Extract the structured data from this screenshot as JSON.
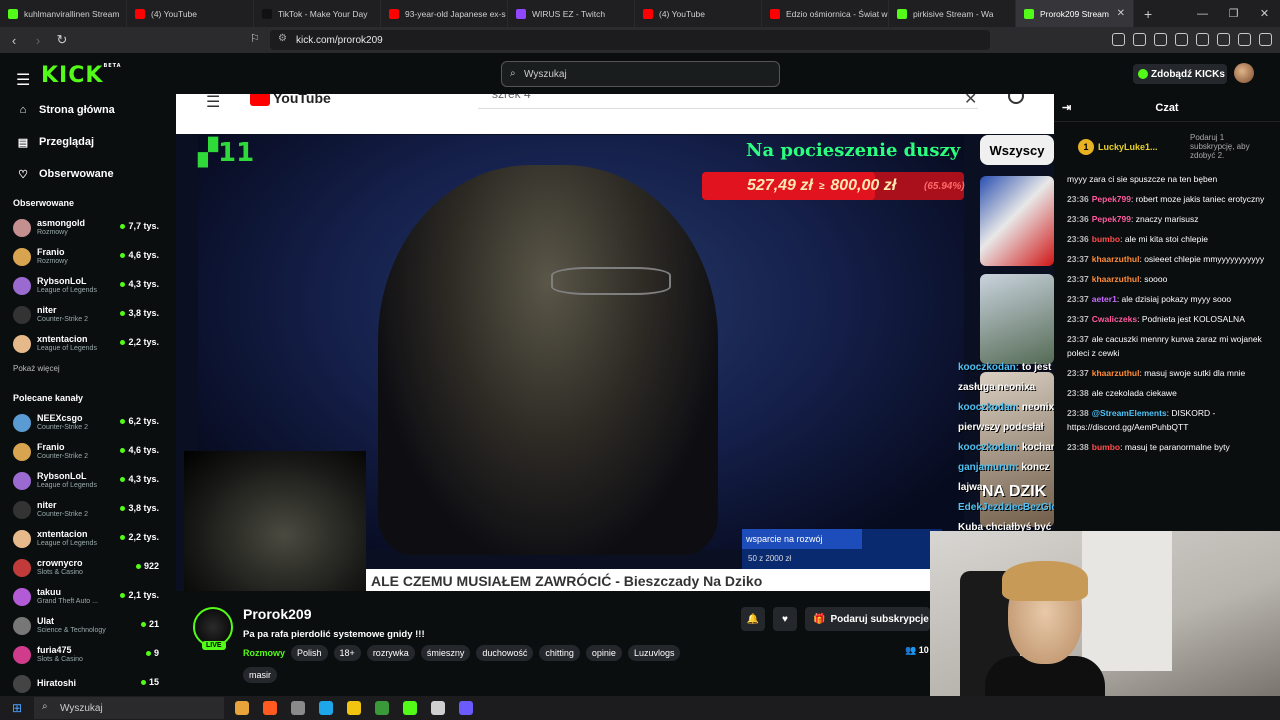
{
  "tabs": [
    {
      "label": "kuhlmanvirallinen Stream",
      "color": "#53fc18"
    },
    {
      "label": "(4) YouTube",
      "color": "#ff0000"
    },
    {
      "label": "TikTok - Make Your Day",
      "color": "#111111"
    },
    {
      "label": "93-year-old Japanese ex-s",
      "color": "#ff0000"
    },
    {
      "label": "WIRUS EZ - Twitch",
      "color": "#9146ff"
    },
    {
      "label": "(4) YouTube",
      "color": "#ff0000"
    },
    {
      "label": "Edzio ośmiornica - Świat w",
      "color": "#ff0000"
    },
    {
      "label": "pirkisive Stream - Wa",
      "color": "#53fc18"
    },
    {
      "label": "Prorok209 Stream",
      "color": "#53fc18",
      "active": true
    }
  ],
  "address": {
    "url": "kick.com/prorok209"
  },
  "top": {
    "search_placeholder": "Wyszukaj",
    "kicks_button": "Zdobądź KICKs",
    "logo": "KICK",
    "logo_tag": "BETA"
  },
  "sidebar": {
    "nav": [
      {
        "label": "Strona główna",
        "icon": "home-icon"
      },
      {
        "label": "Przeglądaj",
        "icon": "browse-icon"
      },
      {
        "label": "Obserwowane",
        "icon": "heart-icon"
      }
    ],
    "followed_title": "Obserwowane",
    "followed": [
      {
        "name": "asmongold",
        "game": "Rozmowy",
        "viewers": "7,7 tys.",
        "color": "#c48f8f"
      },
      {
        "name": "Franio",
        "game": "Rozmowy",
        "viewers": "4,6 tys.",
        "color": "#d9a44f"
      },
      {
        "name": "RybsonLoL",
        "game": "League of Legends",
        "viewers": "4,3 tys.",
        "color": "#9a6ad0"
      },
      {
        "name": "niter",
        "game": "Counter-Strike 2",
        "viewers": "3,8 tys.",
        "color": "#333333"
      },
      {
        "name": "xntentacion",
        "game": "League of Legends",
        "viewers": "2,2 tys.",
        "color": "#e6b98a"
      }
    ],
    "show_more": "Pokaż więcej",
    "recommended_title": "Polecane kanały",
    "recommended": [
      {
        "name": "NEEXcsgo",
        "game": "Counter-Strike 2",
        "viewers": "6,2 tys.",
        "color": "#5a9bd4"
      },
      {
        "name": "Franio",
        "game": "Counter-Strike 2",
        "viewers": "4,6 tys.",
        "color": "#d9a44f"
      },
      {
        "name": "RybsonLoL",
        "game": "League of Legends",
        "viewers": "4,3 tys.",
        "color": "#9a6ad0"
      },
      {
        "name": "niter",
        "game": "Counter-Strike 2",
        "viewers": "3,8 tys.",
        "color": "#333333"
      },
      {
        "name": "xntentacion",
        "game": "League of Legends",
        "viewers": "2,2 tys.",
        "color": "#e6b98a"
      },
      {
        "name": "crownycro",
        "game": "Slots & Casino",
        "viewers": "922",
        "color": "#c23b3b"
      },
      {
        "name": "takuu",
        "game": "Grand Theft Auto ...",
        "viewers": "2,1 tys.",
        "color": "#b35bd6"
      },
      {
        "name": "Ulat",
        "game": "Science & Technology",
        "viewers": "21",
        "color": "#777777"
      },
      {
        "name": "furia475",
        "game": "Slots & Casino",
        "viewers": "9",
        "color": "#d03b8c"
      },
      {
        "name": "Hiratoshi",
        "game": "",
        "viewers": "15",
        "color": "#444444"
      }
    ]
  },
  "video": {
    "yt_search": "szrek 4",
    "yt_logo": "YouTube",
    "counter": "11",
    "donation_title": "Na pocieszenie duszy",
    "goal_current": "527,49 zł",
    "goal_sep": "≥",
    "goal_target": "800,00 zł",
    "goal_percent": "(65.94%)",
    "goal_fraction": 0.6594,
    "filter_chip": "Wszyscy",
    "overlay_chat": [
      {
        "user": "kooczkodan:",
        "text": "to jest zasługa neonixa"
      },
      {
        "user": "kooczkodan:",
        "text": "neonix to pierwszy podesłał"
      },
      {
        "user": "kooczkodan:",
        "text": "kochany"
      },
      {
        "user": "ganjamurun:",
        "text": "koncz lajwa"
      },
      {
        "user": "EdekJezdziecBezGlowy:",
        "text": "Kuba chciałbyś być małpą?"
      }
    ],
    "thumb_text": "NA DZIK",
    "support_label": "wsparcie na rozwój",
    "support_value": "50 z 2000 zł",
    "ticker": "ALE CZEMU MUSIAŁEM ZAWRÓCIĆ - Bieszczady Na Dziko"
  },
  "stream": {
    "channel": "Prorok209",
    "live": "LIVE",
    "title": "Pa pa rafa pierdolić systemowe gnidy !!!",
    "category": "Rozmowy",
    "tags": [
      "Polish",
      "18+",
      "rozrywka",
      "śmieszny",
      "duchowość",
      "chitting",
      "opinie",
      "Luzuvlogs",
      "masir"
    ],
    "sub_button": "Podaruj subskrypcje",
    "viewers": "10"
  },
  "chat": {
    "title": "Czat",
    "pinned_user": "LuckyLuke1...",
    "pinned_note": "Podaruj 1 subskrypcję, aby zdobyć 2.",
    "messages": [
      {
        "time": "",
        "user": "",
        "color": "#ffffff",
        "text": "myyy zara ci sie spuszcze na ten bęben"
      },
      {
        "time": "23:36",
        "user": "Pepek799",
        "color": "#ff5a9e",
        "text": "robert moze jakis taniec erotyczny"
      },
      {
        "time": "23:36",
        "user": "Pepek799",
        "color": "#ff5a9e",
        "text": "znaczy marisusz"
      },
      {
        "time": "23:36",
        "user": "bumbo",
        "color": "#ff4d4d",
        "text": "ale mi kita stoi chlepie"
      },
      {
        "time": "23:37",
        "user": "khaarzuthul",
        "color": "#ff8c3a",
        "text": "osieeet chlepie mmyyyyyyyyyyy"
      },
      {
        "time": "23:37",
        "user": "khaarzuthul",
        "color": "#ff8c3a",
        "text": "soooo"
      },
      {
        "time": "23:37",
        "user": "aeter1",
        "color": "#c86bff",
        "text": "ale dzisiaj pokazy myyy sooo"
      },
      {
        "time": "23:37",
        "user": "Cwaliczeks",
        "color": "#ff5a9e",
        "text": "Podnieta jest KOLOSALNA"
      },
      {
        "time": "23:37",
        "user": "",
        "color": "#ffffff",
        "text": "ale cacuszki mennry kurwa zaraz mi wojanek poleci z cewki"
      },
      {
        "time": "23:37",
        "user": "khaarzuthul",
        "color": "#ff8c3a",
        "text": "masuj swoje sutki dla mnie"
      },
      {
        "time": "23:38",
        "user": "",
        "color": "#ffffff",
        "text": "ale czekolada ciekawe"
      },
      {
        "time": "23:38",
        "user": "@StreamElements",
        "color": "#4fc3f7",
        "text": "DISKORD - https://discord.gg/AemPuhbQTT"
      },
      {
        "time": "23:38",
        "user": "bumbo",
        "color": "#ff4d4d",
        "text": "masuj te paranormalne byty"
      }
    ]
  },
  "taskbar": {
    "search": "Wyszukaj",
    "apps": [
      "#e8a33a",
      "#ff5a1f",
      "#8a8a8a",
      "#1ea7e8",
      "#f1c40f",
      "#3a9a3a",
      "#53fc18",
      "#cfcfcf",
      "#6b5bff"
    ]
  }
}
